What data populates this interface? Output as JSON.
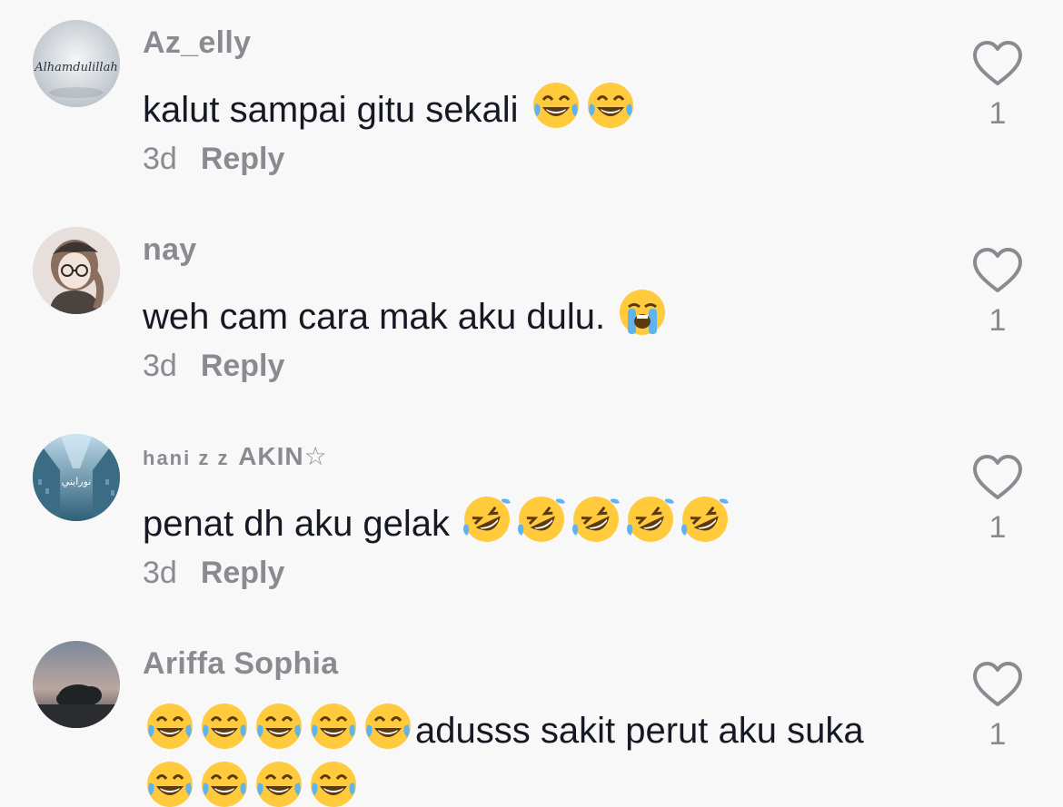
{
  "comments": [
    {
      "username": "Az_elly",
      "text": "kalut sampai gitu sekali",
      "emoji": [
        "joy",
        "joy"
      ],
      "time": "3d",
      "reply_label": "Reply",
      "likes": "1",
      "avatar_text": "Alhamdulillah"
    },
    {
      "username": "nay",
      "text": "weh cam cara mak aku dulu.",
      "emoji": [
        "sob"
      ],
      "time": "3d",
      "reply_label": "Reply",
      "likes": "1"
    },
    {
      "username_small": "hani z z",
      "username_big": "AKIN",
      "username_star": "☆",
      "text": "penat dh aku gelak",
      "emoji": [
        "rofl",
        "rofl",
        "rofl",
        "rofl",
        "rofl"
      ],
      "time": "3d",
      "reply_label": "Reply",
      "likes": "1"
    },
    {
      "username": "Ariffa Sophia",
      "text": "adusss sakit perut aku suka",
      "emoji_before": [
        "joy",
        "joy",
        "joy",
        "joy",
        "joy"
      ],
      "emoji_after": [
        "joy",
        "joy",
        "joy",
        "joy"
      ],
      "likes": "1"
    }
  ],
  "colors": {
    "background": "#f8f8f8",
    "meta": "#8a8b91",
    "text": "#161823"
  }
}
